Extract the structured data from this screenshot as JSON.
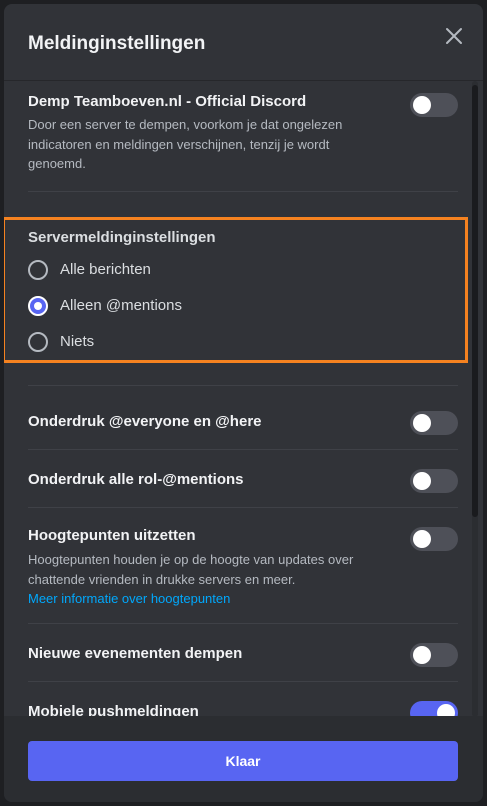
{
  "modal": {
    "title": "Meldinginstellingen"
  },
  "mute_server": {
    "title": "Demp Teamboeven.nl - Official Discord",
    "description": "Door een server te dempen, voorkom je dat ongelezen indicatoren en meldingen verschijnen, tenzij je wordt genoemd.",
    "enabled": false
  },
  "server_notifications": {
    "label": "Servermeldinginstellingen",
    "options": [
      {
        "label": "Alle berichten",
        "selected": false
      },
      {
        "label": "Alleen @mentions",
        "selected": true
      },
      {
        "label": "Niets",
        "selected": false
      }
    ]
  },
  "suppress_everyone": {
    "title": "Onderdruk @everyone en @here",
    "enabled": false
  },
  "suppress_roles": {
    "title": "Onderdruk alle rol-@mentions",
    "enabled": false
  },
  "highlights": {
    "title": "Hoogtepunten uitzetten",
    "description": "Hoogtepunten houden je op de hoogte van updates over chattende vrienden in drukke servers en meer.",
    "link": "Meer informatie over hoogtepunten",
    "enabled": false
  },
  "mute_events": {
    "title": "Nieuwe evenementen dempen",
    "enabled": false
  },
  "mobile_push": {
    "title": "Mobiele pushmeldingen",
    "enabled": true
  },
  "footer": {
    "done_label": "Klaar"
  },
  "colors": {
    "accent": "#5865f2",
    "highlight_border": "#f58220",
    "link": "#00a8fc"
  }
}
